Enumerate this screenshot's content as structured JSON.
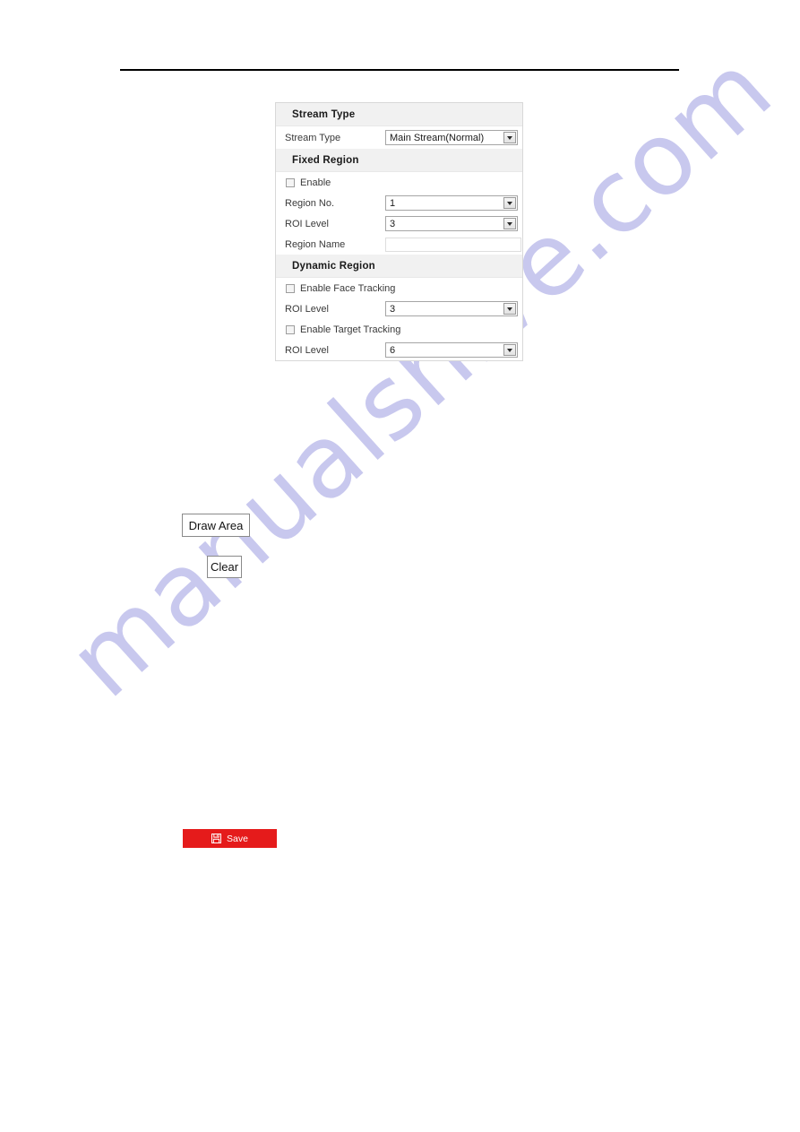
{
  "page": {
    "watermark": "manualshive.com"
  },
  "panel": {
    "sections": [
      {
        "id": "stream-type",
        "title": "Stream Type",
        "rows": [
          {
            "kind": "select",
            "label": "Stream Type",
            "value": "Main Stream(Normal)"
          }
        ]
      },
      {
        "id": "fixed-region",
        "title": "Fixed Region",
        "rows": [
          {
            "kind": "checkbox",
            "label": "Enable",
            "checked": false
          },
          {
            "kind": "select",
            "label": "Region No.",
            "value": "1"
          },
          {
            "kind": "select",
            "label": "ROI Level",
            "value": "3"
          },
          {
            "kind": "input",
            "label": "Region Name",
            "value": "",
            "placeholder": ""
          }
        ]
      },
      {
        "id": "dynamic-region",
        "title": "Dynamic Region",
        "rows": [
          {
            "kind": "checkbox",
            "label": "Enable Face Tracking",
            "checked": false
          },
          {
            "kind": "select",
            "label": "ROI Level",
            "value": "3"
          },
          {
            "kind": "checkbox",
            "label": "Enable Target Tracking",
            "checked": false
          },
          {
            "kind": "select",
            "label": "ROI Level",
            "value": "6"
          }
        ]
      }
    ]
  },
  "actions": {
    "draw_area_label": "Draw Area",
    "clear_label": "Clear",
    "save_label": "Save",
    "save_icon": "save-floppy-icon",
    "save_color": "#e51b1b"
  }
}
